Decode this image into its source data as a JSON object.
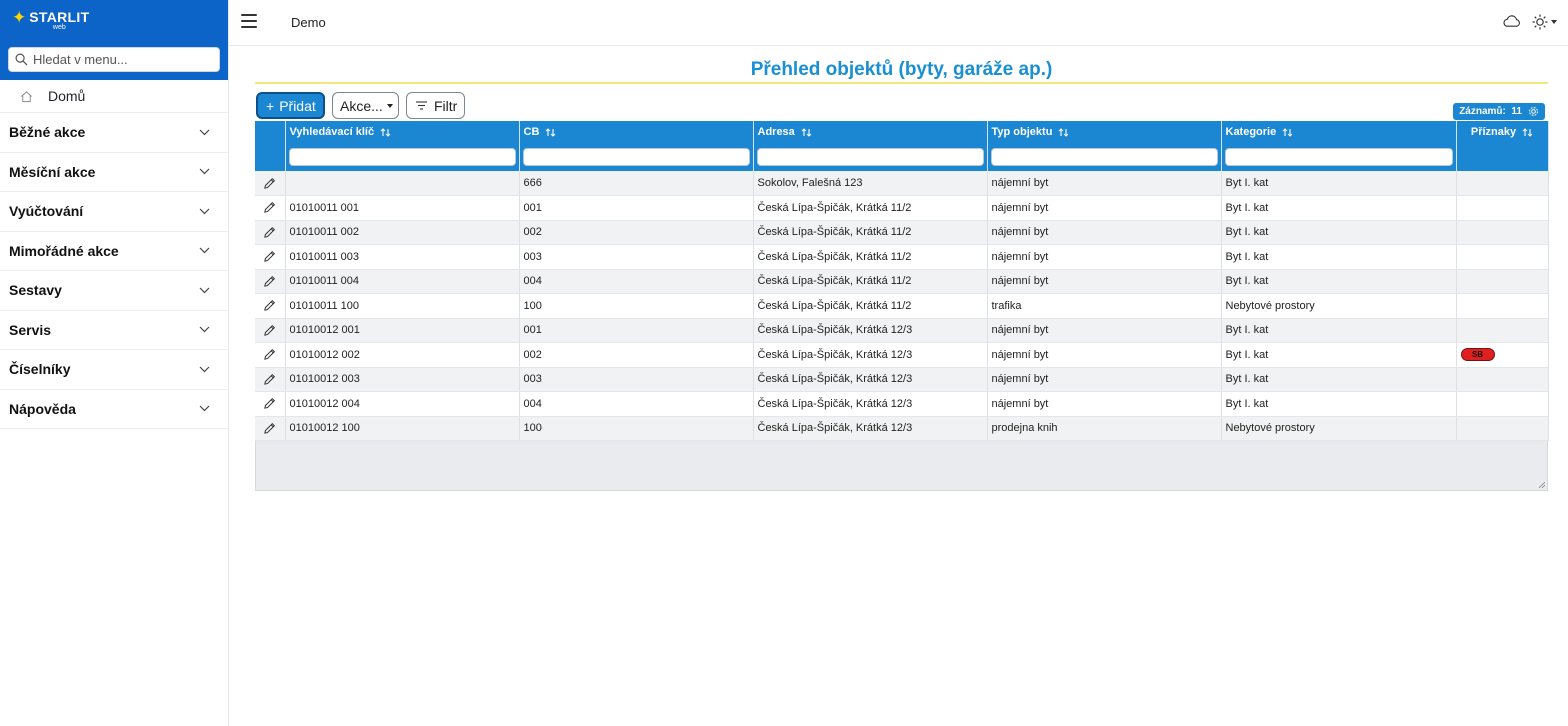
{
  "brand": {
    "name": "STARLIT",
    "sub": "web"
  },
  "sidebar": {
    "search_placeholder": "Hledat v menu...",
    "home": "Domů",
    "items": [
      {
        "label": "Běžné akce"
      },
      {
        "label": "Měsíční akce"
      },
      {
        "label": "Vyúčtování"
      },
      {
        "label": "Mimořádné akce"
      },
      {
        "label": "Sestavy"
      },
      {
        "label": "Servis"
      },
      {
        "label": "Číselníky"
      },
      {
        "label": "Nápověda"
      }
    ]
  },
  "topbar": {
    "title": "Demo",
    "icons": [
      "menu-icon",
      "cloud-icon",
      "sun-icon"
    ]
  },
  "page": {
    "title": "Přehled objektů (byty, garáže ap.)",
    "add_label": "Přidat",
    "actions_label": "Akce...",
    "filter_label": "Filtr",
    "records_label": "Záznamů:",
    "records_count": "11"
  },
  "colors": {
    "brand": "#0c63c8",
    "accent": "#1b86d1",
    "title": "#1a8fd1",
    "badge": "#e02020"
  },
  "table": {
    "columns": [
      "Vyhledávací klíč",
      "CB",
      "Adresa",
      "Typ objektu",
      "Kategorie",
      "Příznaky"
    ],
    "rows": [
      [
        "",
        "666",
        "Sokolov, Falešná 123",
        "nájemní byt",
        "Byt I. kat",
        ""
      ],
      [
        "01010011 001",
        "001",
        "Česká Lípa-Špičák, Krátká 11/2",
        "nájemní byt",
        "Byt I. kat",
        ""
      ],
      [
        "01010011 002",
        "002",
        "Česká Lípa-Špičák, Krátká 11/2",
        "nájemní byt",
        "Byt I. kat",
        ""
      ],
      [
        "01010011 003",
        "003",
        "Česká Lípa-Špičák, Krátká 11/2",
        "nájemní byt",
        "Byt I. kat",
        ""
      ],
      [
        "01010011 004",
        "004",
        "Česká Lípa-Špičák, Krátká 11/2",
        "nájemní byt",
        "Byt I. kat",
        ""
      ],
      [
        "01010011 100",
        "100",
        "Česká Lípa-Špičák, Krátká 11/2",
        "trafika",
        "Nebytové prostory",
        ""
      ],
      [
        "01010012 001",
        "001",
        "Česká Lípa-Špičák, Krátká 12/3",
        "nájemní byt",
        "Byt I. kat",
        ""
      ],
      [
        "01010012 002",
        "002",
        "Česká Lípa-Špičák, Krátká 12/3",
        "nájemní byt",
        "Byt I. kat",
        "SB"
      ],
      [
        "01010012 003",
        "003",
        "Česká Lípa-Špičák, Krátká 12/3",
        "nájemní byt",
        "Byt I. kat",
        ""
      ],
      [
        "01010012 004",
        "004",
        "Česká Lípa-Špičák, Krátká 12/3",
        "nájemní byt",
        "Byt I. kat",
        ""
      ],
      [
        "01010012 100",
        "100",
        "Česká Lípa-Špičák, Krátká 12/3",
        "prodejna knih",
        "Nebytové prostory",
        ""
      ]
    ]
  }
}
